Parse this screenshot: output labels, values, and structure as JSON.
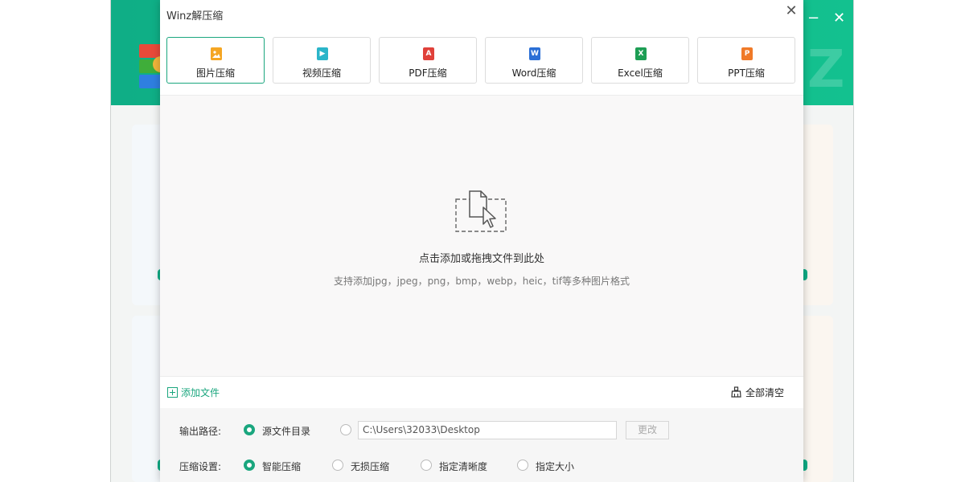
{
  "dialog": {
    "title": "Winz解压缩",
    "close_symbol": "✕"
  },
  "tabs": [
    {
      "label": "图片压缩",
      "icon": "image-icon",
      "color": "#f5a623",
      "glyph": "",
      "active": true
    },
    {
      "label": "视频压缩",
      "icon": "video-icon",
      "color": "#2bb5c9",
      "glyph": "▶",
      "active": false
    },
    {
      "label": "PDF压缩",
      "icon": "pdf-icon",
      "color": "#e0413a",
      "glyph": "A",
      "active": false
    },
    {
      "label": "Word压缩",
      "icon": "word-icon",
      "color": "#2b6fd6",
      "glyph": "W",
      "active": false
    },
    {
      "label": "Excel压缩",
      "icon": "excel-icon",
      "color": "#1d9e54",
      "glyph": "X",
      "active": false
    },
    {
      "label": "PPT压缩",
      "icon": "ppt-icon",
      "color": "#f07a28",
      "glyph": "P",
      "active": false
    }
  ],
  "dropzone": {
    "main_text": "点击添加或拖拽文件到此处",
    "sub_text": "支持添加jpg，jpeg，png，bmp，webp，heic，tif等多种图片格式",
    "icon": "file-drop-icon"
  },
  "toolbar": {
    "add_label": "添加文件",
    "clear_label": "全部清空"
  },
  "output": {
    "label": "输出路径:",
    "source_option": "源文件目录",
    "path_value": "C:\\Users\\32033\\Desktop",
    "change_label": "更改"
  },
  "compression": {
    "label": "压缩设置:",
    "options": [
      "智能压缩",
      "无损压缩",
      "指定清晰度",
      "指定大小"
    ]
  },
  "colors": {
    "accent": "#1aa67e",
    "header": "#13c18f"
  }
}
